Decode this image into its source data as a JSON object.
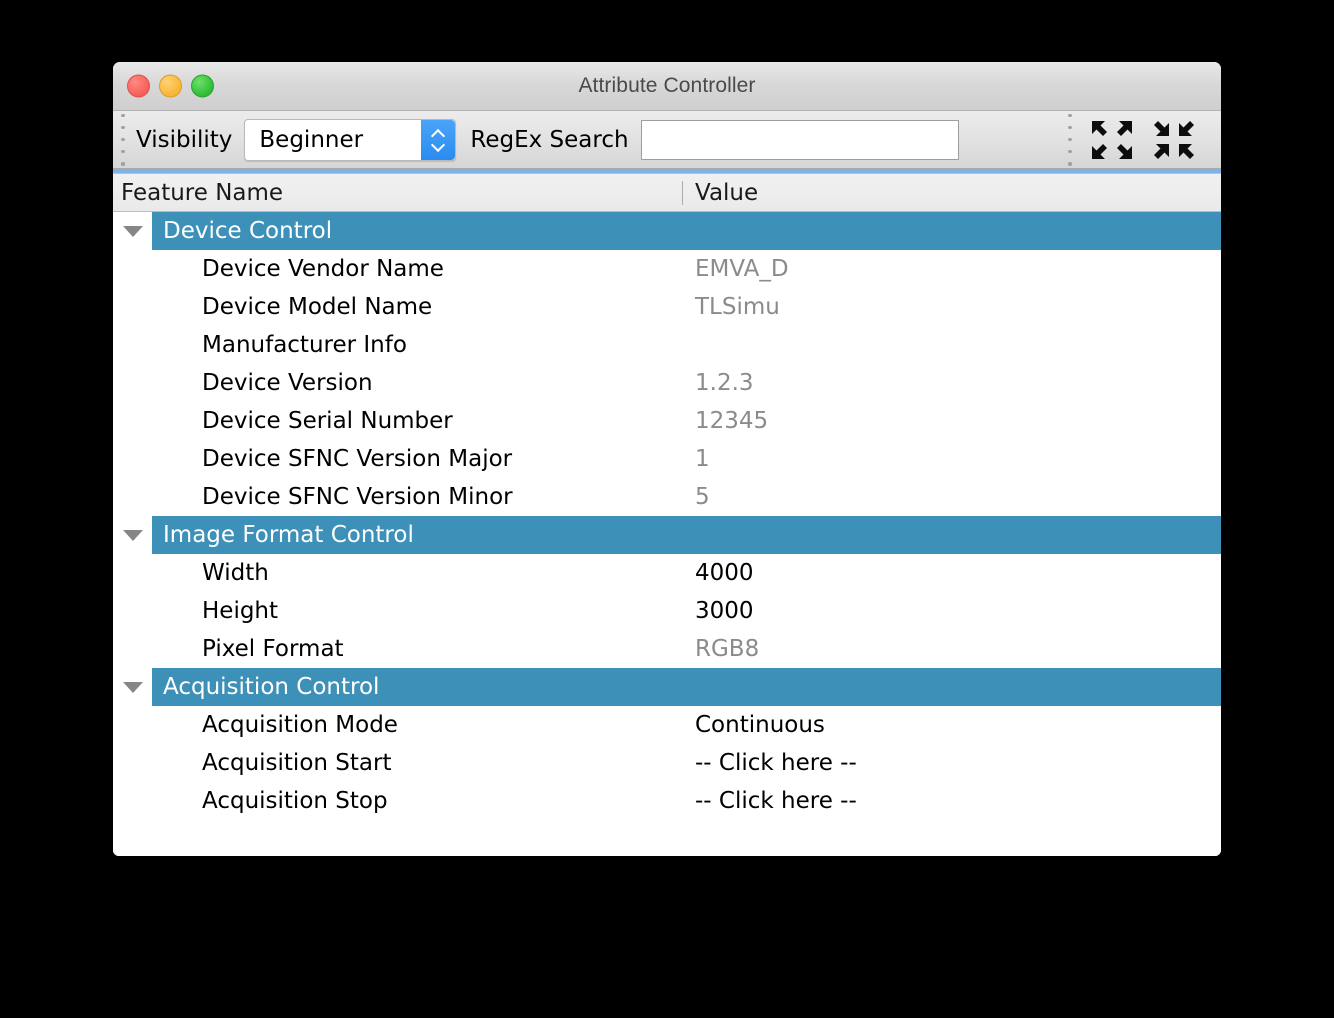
{
  "window": {
    "title": "Attribute Controller",
    "traffic_lights": {
      "close": "close-button",
      "minimize": "minimize-button",
      "maximize": "maximize-button"
    }
  },
  "toolbar": {
    "visibility_label": "Visibility",
    "visibility_value": "Beginner",
    "visibility_options": [
      "Beginner"
    ],
    "regex_label": "RegEx Search",
    "regex_value": "",
    "regex_placeholder": "",
    "expand_all_icon": "expand-all-icon",
    "collapse_all_icon": "collapse-all-icon"
  },
  "table": {
    "columns": [
      "Feature Name",
      "Value"
    ],
    "groups": [
      {
        "name": "Device Control",
        "expanded": true,
        "rows": [
          {
            "name": "Device Vendor Name",
            "value": "EMVA_D",
            "editable": false
          },
          {
            "name": "Device Model Name",
            "value": "TLSimu",
            "editable": false
          },
          {
            "name": "Manufacturer Info",
            "value": "",
            "editable": false
          },
          {
            "name": "Device Version",
            "value": "1.2.3",
            "editable": false
          },
          {
            "name": "Device Serial Number",
            "value": "12345",
            "editable": false
          },
          {
            "name": "Device SFNC Version Major",
            "value": "1",
            "editable": false
          },
          {
            "name": "Device SFNC Version Minor",
            "value": "5",
            "editable": false
          }
        ]
      },
      {
        "name": "Image Format Control",
        "expanded": true,
        "rows": [
          {
            "name": "Width",
            "value": "4000",
            "editable": true
          },
          {
            "name": "Height",
            "value": "3000",
            "editable": true
          },
          {
            "name": "Pixel Format",
            "value": "RGB8",
            "editable": false
          }
        ]
      },
      {
        "name": "Acquisition Control",
        "expanded": true,
        "rows": [
          {
            "name": "Acquisition Mode",
            "value": "Continuous",
            "editable": true
          },
          {
            "name": "Acquisition Start",
            "value": "-- Click here --",
            "editable": true
          },
          {
            "name": "Acquisition Stop",
            "value": "-- Click here --",
            "editable": true
          }
        ]
      }
    ]
  },
  "colors": {
    "group_accent": "#3d90b8",
    "readonly_text": "#8b8b8b",
    "editable_text": "#000000",
    "stepper_blue": "#2a8cf0",
    "focus_ring": "#7fb2e5"
  }
}
